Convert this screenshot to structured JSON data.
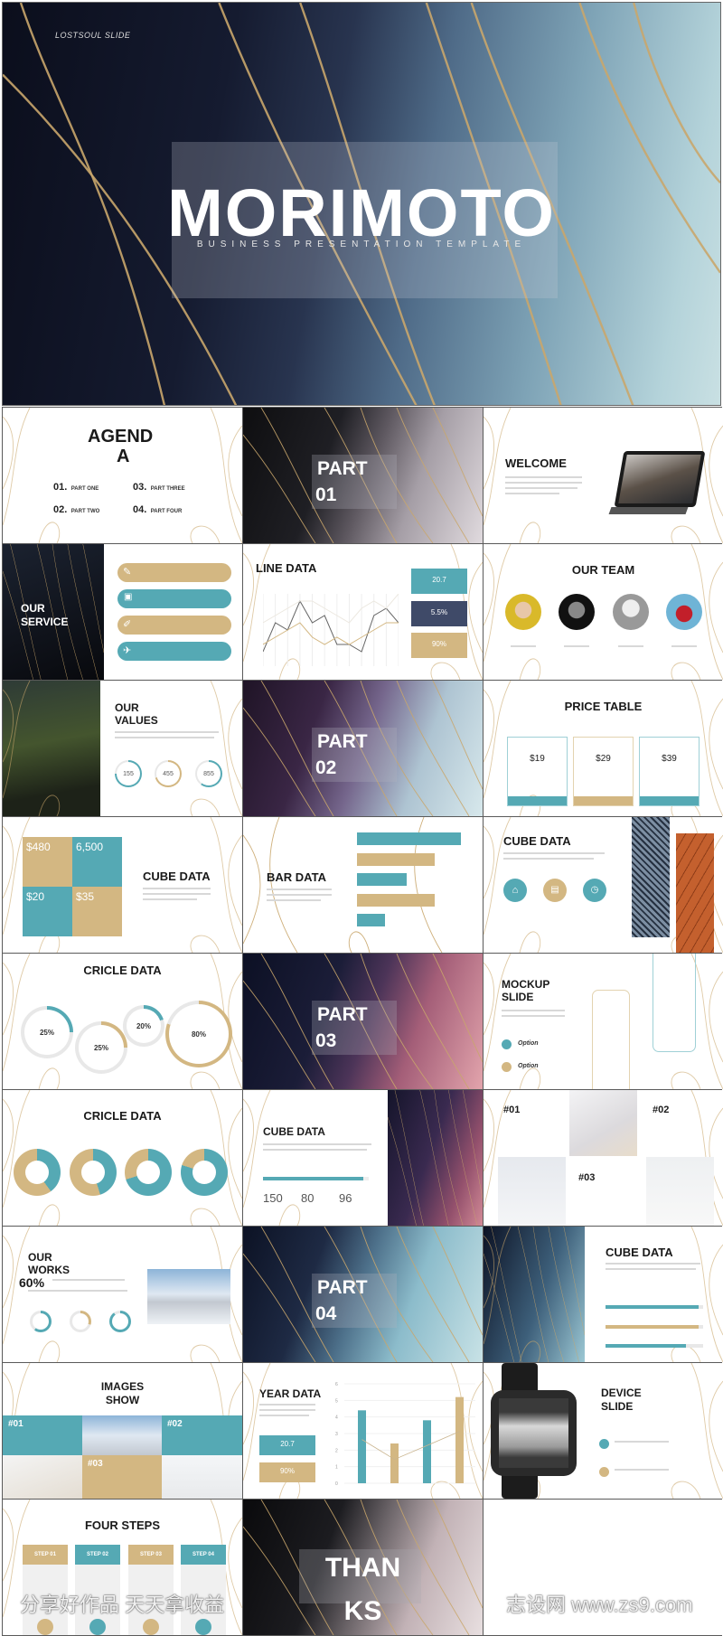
{
  "hero": {
    "brand": "LOSTSOUL SLIDE",
    "title": "MORIMOTO",
    "subtitle": "BUSINESS PRESENTATION TEMPLATE"
  },
  "colors": {
    "teal": "#55a9b4",
    "gold": "#d3b782",
    "navy": "#3f4a68",
    "gold_line": "#c9a66b"
  },
  "agenda": {
    "title_1": "AGEND",
    "title_2": "A",
    "items": [
      {
        "num": "01.",
        "label": "PART ONE"
      },
      {
        "num": "02.",
        "label": "PART TWO"
      },
      {
        "num": "03.",
        "label": "PART THREE"
      },
      {
        "num": "04.",
        "label": "PART FOUR"
      }
    ]
  },
  "parts": [
    {
      "label": "PART",
      "num": "01"
    },
    {
      "label": "PART",
      "num": "02"
    },
    {
      "label": "PART",
      "num": "03"
    },
    {
      "label": "PART",
      "num": "04"
    }
  ],
  "welcome": {
    "title": "WELCOME"
  },
  "service": {
    "title_1": "OUR",
    "title_2": "SERVICE",
    "icons": [
      "pencil-icon",
      "lock-icon",
      "pen-icon",
      "rocket-icon"
    ]
  },
  "line_data": {
    "title": "LINE DATA",
    "stats": [
      "20.7",
      "5.5%",
      "90%"
    ],
    "series": [
      [
        2,
        6,
        5,
        9,
        6,
        7,
        3,
        3,
        2,
        7,
        8,
        6
      ],
      [
        3,
        4,
        5,
        6,
        4,
        3,
        4,
        3,
        4,
        5,
        6,
        6
      ],
      [
        6,
        7,
        8,
        9,
        9,
        8,
        7,
        6,
        8,
        9,
        8,
        10
      ]
    ]
  },
  "team": {
    "title": "OUR TEAM"
  },
  "values": {
    "title_1": "OUR",
    "title_2": "VALUES",
    "rings": [
      {
        "value": "155",
        "fill": 0.75
      },
      {
        "value": "455",
        "fill": 0.7
      },
      {
        "value": "855",
        "fill": 0.6
      }
    ]
  },
  "price": {
    "title": "PRICE TABLE",
    "plans": [
      "$19",
      "$29",
      "$39"
    ]
  },
  "cube1": {
    "title": "CUBE DATA",
    "cells": [
      "$480",
      "6,500",
      "$20",
      "$35"
    ]
  },
  "bar": {
    "title": "BAR DATA",
    "values": [
      100,
      75,
      48,
      75,
      27
    ]
  },
  "cube2": {
    "title": "CUBE DATA"
  },
  "circle1": {
    "title": "CRICLE DATA",
    "items": [
      {
        "value": "25%",
        "fill": 0.25
      },
      {
        "value": "25%",
        "fill": 0.25
      },
      {
        "value": "20%",
        "fill": 0.2
      },
      {
        "value": "80%",
        "fill": 0.8
      }
    ]
  },
  "mockup": {
    "title_1": "MOCKUP",
    "title_2": "SLIDE",
    "options": [
      "Option",
      "Option"
    ]
  },
  "circle2": {
    "title": "CRICLE DATA",
    "teal_share": [
      0.4,
      0.45,
      0.7,
      0.8
    ]
  },
  "cube3": {
    "title": "CUBE DATA",
    "progress": 0.95,
    "stats": [
      "150",
      "80",
      "96"
    ]
  },
  "gallery": {
    "labels": [
      "#01",
      "#02",
      "#03"
    ]
  },
  "works": {
    "title_1": "OUR",
    "title_2": "WORKS",
    "percent": "60%",
    "rings": [
      0.6,
      0.3,
      0.9
    ]
  },
  "cube4": {
    "title": "CUBE DATA",
    "progress": [
      0.95,
      0.95,
      0.82
    ]
  },
  "images_show": {
    "title_1": "IMAGES",
    "title_2": "SHOW",
    "labels": [
      "#01",
      "#02",
      "#03"
    ]
  },
  "year": {
    "title": "YEAR DATA",
    "stats": [
      "20.7",
      "90%"
    ],
    "bars": [
      4.4,
      2.4,
      3.8,
      5.2
    ],
    "yticks": [
      "0",
      "1",
      "2",
      "3",
      "4",
      "5",
      "6"
    ]
  },
  "device": {
    "title_1": "DEVICE",
    "title_2": "SLIDE"
  },
  "steps": {
    "title": "FOUR STEPS",
    "items": [
      "STEP 01",
      "STEP 02",
      "STEP 03",
      "STEP 04"
    ]
  },
  "thanks": {
    "title_1": "THAN",
    "title_2": "KS"
  },
  "watermark": {
    "left": "分享好作品 天天拿收益",
    "right": "志设网 www.zs9.com"
  }
}
